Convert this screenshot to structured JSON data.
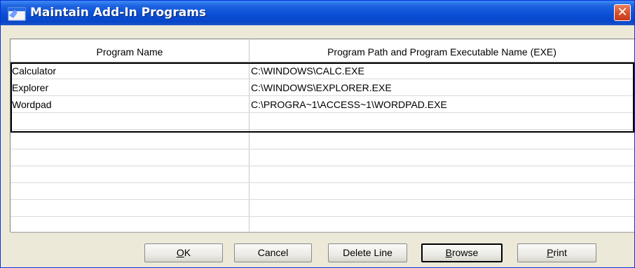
{
  "window": {
    "title": "Maintain Add-In Programs",
    "close_glyph": "✕",
    "app_icon": "app-window-icon"
  },
  "grid": {
    "columns": [
      "Program Name",
      "Program Path and Program Executable Name (EXE)"
    ],
    "rows": [
      {
        "name": "Calculator",
        "path": "C:\\WINDOWS\\CALC.EXE"
      },
      {
        "name": "Explorer",
        "path": "C:\\WINDOWS\\EXPLORER.EXE"
      },
      {
        "name": "Wordpad",
        "path": "C:\\PROGRA~1\\ACCESS~1\\WORDPAD.EXE"
      },
      {
        "name": "",
        "path": ""
      },
      {
        "name": "",
        "path": ""
      },
      {
        "name": "",
        "path": ""
      },
      {
        "name": "",
        "path": ""
      },
      {
        "name": "",
        "path": ""
      },
      {
        "name": "",
        "path": ""
      },
      {
        "name": "",
        "path": ""
      }
    ]
  },
  "buttons": {
    "ok": {
      "key": "O",
      "rest": "K"
    },
    "cancel": "Cancel",
    "delete_line": "Delete Line",
    "browse": {
      "key": "B",
      "rest": "rowse"
    },
    "print": {
      "key": "P",
      "rest": "rint"
    }
  },
  "colors": {
    "titlebar": "#0a4fd6",
    "close": "#d9532f",
    "dialog_face": "#ece9d8"
  }
}
